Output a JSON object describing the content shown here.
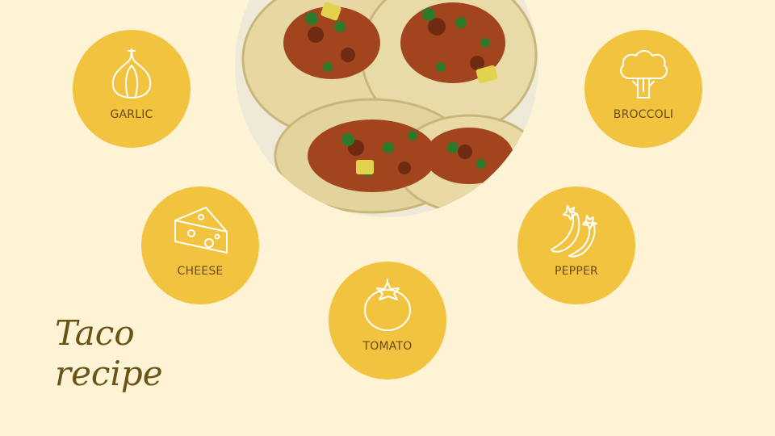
{
  "slide": {
    "title_line1": "Taco",
    "title_line2": "recipe",
    "background": "#FFF3D6",
    "bubble_color": "#F2C33F",
    "label_color": "#6A4A14",
    "title_color": "#6B5318"
  },
  "ingredients": [
    {
      "label": "GARLIC",
      "icon": "garlic-icon"
    },
    {
      "label": "CHEESE",
      "icon": "cheese-icon"
    },
    {
      "label": "TOMATO",
      "icon": "tomato-icon"
    },
    {
      "label": "PEPPER",
      "icon": "pepper-icon"
    },
    {
      "label": "BROCCOLI",
      "icon": "broccoli-icon"
    }
  ],
  "photo": {
    "subject": "tacos-photo"
  }
}
